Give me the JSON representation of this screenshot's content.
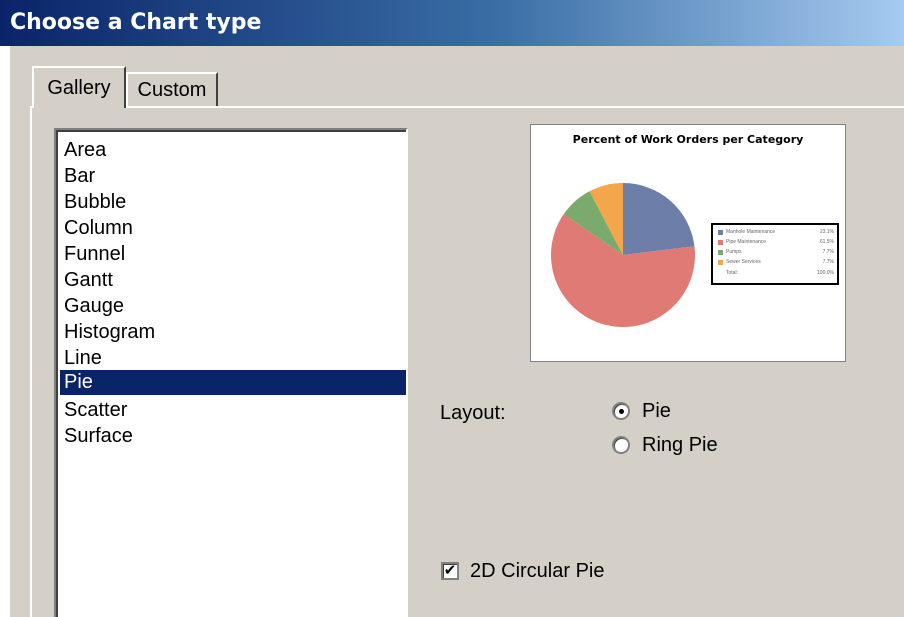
{
  "window": {
    "title": "Choose a Chart type"
  },
  "tabs": [
    {
      "label": "Gallery",
      "active": true
    },
    {
      "label": "Custom",
      "active": false
    }
  ],
  "chart_types": [
    "Area",
    "Bar",
    "Bubble",
    "Column",
    "Funnel",
    "Gantt",
    "Gauge",
    "Histogram",
    "Line",
    "Pie",
    "Scatter",
    "Surface"
  ],
  "selected_chart_type": "Pie",
  "preview": {
    "title": "Percent of Work Orders per Category",
    "legend": [
      {
        "label": "Manhole Maintenance",
        "value": "23.1%",
        "color": "#6d7fa8"
      },
      {
        "label": "Pipe Maintenance",
        "value": "61.5%",
        "color": "#e07a74"
      },
      {
        "label": "Pumps",
        "value": "7.7%",
        "color": "#7bab6c"
      },
      {
        "label": "Sewer Services",
        "value": "7.7%",
        "color": "#f4a64a"
      }
    ],
    "total_label": "Total:",
    "total_value": "100.0%"
  },
  "chart_data": {
    "type": "pie",
    "title": "Percent of Work Orders per Category",
    "categories": [
      "Manhole Maintenance",
      "Pipe Maintenance",
      "Pumps",
      "Sewer Services"
    ],
    "values": [
      23.1,
      61.5,
      7.7,
      7.7
    ],
    "colors": [
      "#6d7fa8",
      "#e07a74",
      "#7bab6c",
      "#f4a64a"
    ],
    "legend_position": "right"
  },
  "layout": {
    "label": "Layout:",
    "options": [
      {
        "label": "Pie",
        "selected": true
      },
      {
        "label": "Ring Pie",
        "selected": false
      }
    ]
  },
  "circular_pie": {
    "label": "2D Circular Pie",
    "checked": true,
    "check_glyph": "✔"
  },
  "colors": {
    "title_bar_start": "#0a246a",
    "selection": "#0a246a",
    "dialog_bg": "#d4d0c8"
  }
}
